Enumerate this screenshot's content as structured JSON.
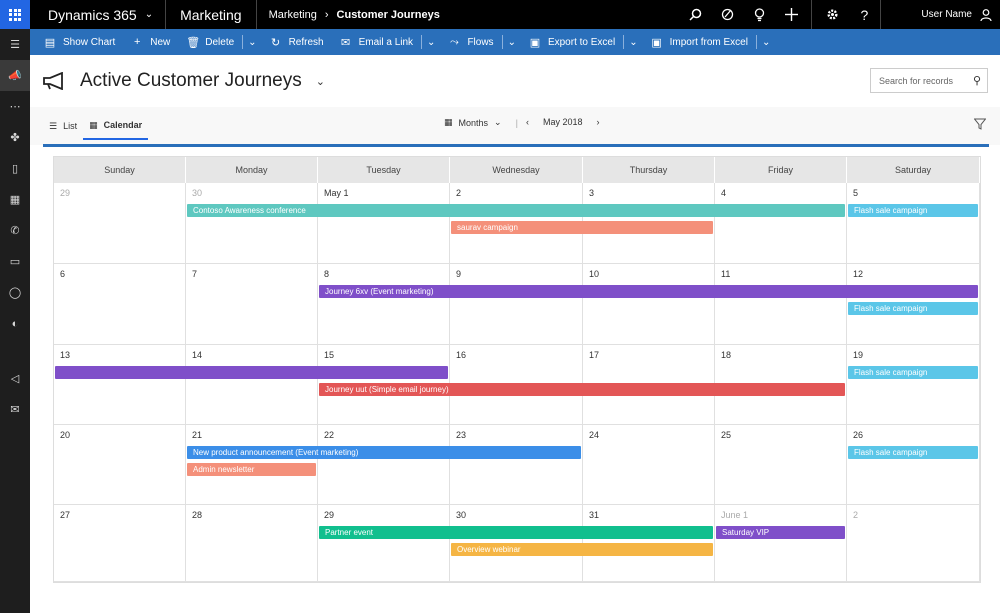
{
  "topbar": {
    "app_name": "Dynamics 365",
    "area": "Marketing",
    "breadcrumb": [
      "Marketing",
      "Customer Journeys"
    ],
    "user": "User Name"
  },
  "commands": [
    {
      "label": "Show Chart",
      "icon": "chart-icon",
      "glyph": "▤",
      "dropdown": false
    },
    {
      "label": "New",
      "icon": "plus-icon",
      "glyph": "+",
      "dropdown": false
    },
    {
      "label": "Delete",
      "icon": "trash-icon",
      "glyph": "🗑",
      "dropdown": true
    },
    {
      "label": "Refresh",
      "icon": "refresh-icon",
      "glyph": "↻",
      "dropdown": false
    },
    {
      "label": "Email a Link",
      "icon": "email-link-icon",
      "glyph": "✉",
      "dropdown": true
    },
    {
      "label": "Flows",
      "icon": "flows-icon",
      "glyph": "⤳",
      "dropdown": true
    },
    {
      "label": "Export to Excel",
      "icon": "excel-icon",
      "glyph": "▣",
      "dropdown": true
    },
    {
      "label": "Import from Excel",
      "icon": "import-icon",
      "glyph": "▣",
      "dropdown": true
    }
  ],
  "page": {
    "title": "Active Customer Journeys",
    "search_placeholder": "Search for records"
  },
  "toolbar": {
    "list_label": "List",
    "calendar_label": "Calendar",
    "period_label": "Months",
    "current_period": "May 2018"
  },
  "calendar": {
    "weekdays": [
      "Sunday",
      "Monday",
      "Tuesday",
      "Wednesday",
      "Thursday",
      "Friday",
      "Saturday"
    ],
    "weeks": [
      [
        {
          "d": "29",
          "dim": true
        },
        {
          "d": "30",
          "dim": true
        },
        {
          "d": "May 1",
          "dim": false
        },
        {
          "d": "2",
          "dim": false
        },
        {
          "d": "3",
          "dim": false
        },
        {
          "d": "4",
          "dim": false
        },
        {
          "d": "5",
          "dim": false
        }
      ],
      [
        {
          "d": "6",
          "dim": false
        },
        {
          "d": "7",
          "dim": false
        },
        {
          "d": "8",
          "dim": false
        },
        {
          "d": "9",
          "dim": false
        },
        {
          "d": "10",
          "dim": false
        },
        {
          "d": "11",
          "dim": false
        },
        {
          "d": "12",
          "dim": false
        }
      ],
      [
        {
          "d": "13",
          "dim": false
        },
        {
          "d": "14",
          "dim": false
        },
        {
          "d": "15",
          "dim": false
        },
        {
          "d": "16",
          "dim": false
        },
        {
          "d": "17",
          "dim": false
        },
        {
          "d": "18",
          "dim": false
        },
        {
          "d": "19",
          "dim": false
        }
      ],
      [
        {
          "d": "20",
          "dim": false
        },
        {
          "d": "21",
          "dim": false
        },
        {
          "d": "22",
          "dim": false
        },
        {
          "d": "23",
          "dim": false
        },
        {
          "d": "24",
          "dim": false
        },
        {
          "d": "25",
          "dim": false
        },
        {
          "d": "26",
          "dim": false
        }
      ],
      [
        {
          "d": "27",
          "dim": false
        },
        {
          "d": "28",
          "dim": false
        },
        {
          "d": "29",
          "dim": false
        },
        {
          "d": "30",
          "dim": false
        },
        {
          "d": "31",
          "dim": false
        },
        {
          "d": "June 1",
          "dim": true
        },
        {
          "d": "2",
          "dim": true
        }
      ]
    ],
    "events": [
      {
        "label": "Contoso Awareness conference",
        "week": 0,
        "start": 1,
        "end": 5,
        "lane": 0,
        "color": "#5ec8c0"
      },
      {
        "label": "Flash sale campaign",
        "week": 0,
        "start": 6,
        "end": 6,
        "lane": 0,
        "color": "#5bc6e8"
      },
      {
        "label": "saurav campaign",
        "week": 0,
        "start": 3,
        "end": 4,
        "lane": 1,
        "color": "#f4907a"
      },
      {
        "label": "Journey 6xv (Event marketing)",
        "week": 1,
        "start": 2,
        "end": 6,
        "lane": 0,
        "color": "#7f4fc9"
      },
      {
        "label": "Flash sale campaign",
        "week": 1,
        "start": 6,
        "end": 6,
        "lane": 1,
        "color": "#5bc6e8"
      },
      {
        "label": "",
        "week": 2,
        "start": 0,
        "end": 2,
        "lane": 0,
        "color": "#7f4fc9"
      },
      {
        "label": "Flash sale campaign",
        "week": 2,
        "start": 6,
        "end": 6,
        "lane": 0,
        "color": "#5bc6e8"
      },
      {
        "label": "Journey uut (Simple email journey)",
        "week": 2,
        "start": 2,
        "end": 5,
        "lane": 1,
        "color": "#e35656"
      },
      {
        "label": "New product announcement (Event marketing)",
        "week": 3,
        "start": 1,
        "end": 3,
        "lane": 0,
        "color": "#3b8ee8"
      },
      {
        "label": "Flash sale campaign",
        "week": 3,
        "start": 6,
        "end": 6,
        "lane": 0,
        "color": "#5bc6e8"
      },
      {
        "label": "Admin newsletter",
        "week": 3,
        "start": 1,
        "end": 1,
        "lane": 1,
        "color": "#f4907a"
      },
      {
        "label": "Partner event",
        "week": 4,
        "start": 2,
        "end": 4,
        "lane": 0,
        "color": "#11bf8e"
      },
      {
        "label": "Saturday VIP",
        "week": 4,
        "start": 5,
        "end": 5,
        "lane": 0,
        "color": "#7f4fc9"
      },
      {
        "label": "Overview webinar",
        "week": 4,
        "start": 3,
        "end": 4,
        "lane": 1,
        "color": "#f5b544"
      }
    ]
  },
  "leftnav": [
    {
      "icon": "hamburger-icon",
      "glyph": "☰"
    },
    {
      "icon": "marketing-area-icon",
      "glyph": "📣"
    },
    {
      "icon": "more-icon",
      "glyph": "⋯"
    },
    {
      "icon": "puzzle-icon",
      "glyph": "✤"
    },
    {
      "icon": "document-icon",
      "glyph": "▯"
    },
    {
      "icon": "calendar-nav-icon",
      "glyph": "▦"
    },
    {
      "icon": "phone-icon",
      "glyph": "✆"
    },
    {
      "icon": "form-icon",
      "glyph": "▭"
    },
    {
      "icon": "person-icon",
      "glyph": "◯"
    },
    {
      "icon": "globe-icon",
      "glyph": "◐"
    },
    {
      "icon": "megaphone-nav-icon",
      "glyph": "◁"
    },
    {
      "icon": "mail-icon",
      "glyph": "✉"
    }
  ]
}
